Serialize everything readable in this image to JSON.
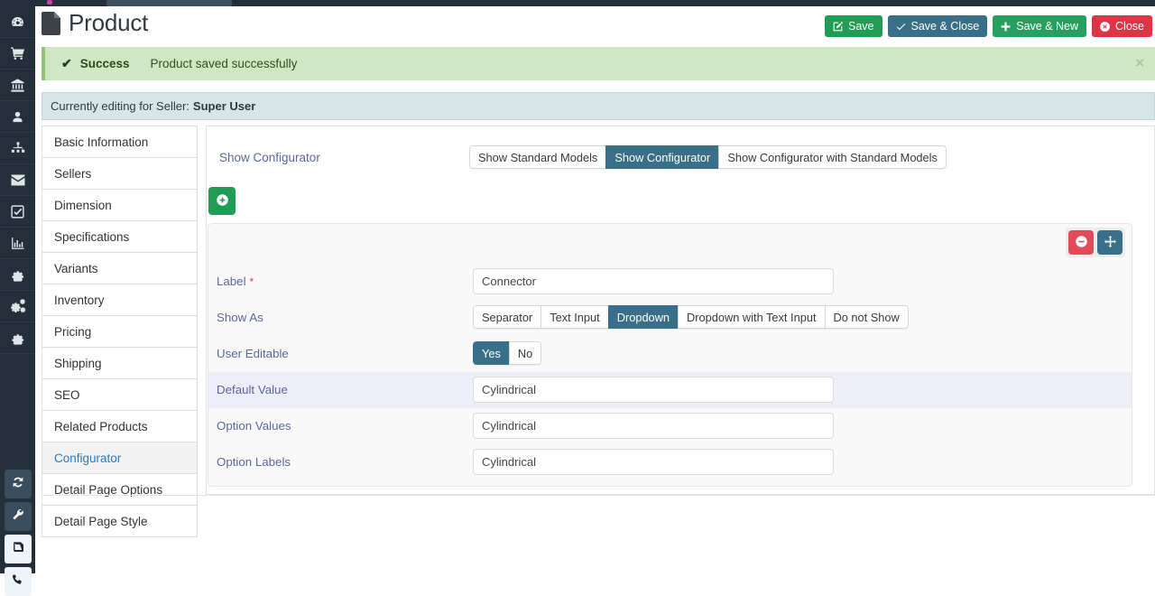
{
  "header": {
    "title": "Product",
    "doc_icon": "document-icon",
    "buttons": [
      {
        "label": "Save",
        "icon": "edit-icon",
        "style": "green"
      },
      {
        "label": "Save & Close",
        "icon": "check-icon",
        "style": "slate"
      },
      {
        "label": "Save & New",
        "icon": "plus-icon",
        "style": "green2"
      },
      {
        "label": "Close",
        "icon": "circle-x-icon",
        "style": "red"
      }
    ]
  },
  "alert": {
    "icon": "check-icon",
    "title": "Success",
    "message": "Product saved successfully",
    "close_label": "×",
    "bg_color": "#cfe8c3",
    "accent_color": "#8dc375"
  },
  "seller_bar": {
    "prefix": "Currently editing for Seller:",
    "seller": "Super User",
    "bg_color": "#d7e5e9"
  },
  "rail": {
    "items": [
      {
        "icon": "dashboard-icon"
      },
      {
        "icon": "shopping-cart-icon"
      },
      {
        "icon": "bank-icon"
      },
      {
        "icon": "user-icon"
      },
      {
        "icon": "sitemap-icon"
      },
      {
        "icon": "envelope-icon"
      },
      {
        "icon": "check-square-icon"
      },
      {
        "icon": "bar-chart-icon"
      },
      {
        "icon": "gear-icon"
      },
      {
        "icon": "gears-icon"
      },
      {
        "icon": "gear-icon"
      }
    ],
    "bottom": [
      {
        "icon": "sync-icon",
        "style": "dark"
      },
      {
        "icon": "wrench-icon",
        "style": "dark"
      },
      {
        "icon": "book-icon",
        "style": "light"
      },
      {
        "icon": "phone-icon",
        "style": "light"
      }
    ]
  },
  "tabs": {
    "active": "Configurator",
    "items": [
      {
        "label": "Basic Information"
      },
      {
        "label": "Sellers"
      },
      {
        "label": "Dimension"
      },
      {
        "label": "Specifications"
      },
      {
        "label": "Variants"
      },
      {
        "label": "Inventory"
      },
      {
        "label": "Pricing"
      },
      {
        "label": "Shipping"
      },
      {
        "label": "SEO"
      },
      {
        "label": "Related Products"
      },
      {
        "label": "Configurator"
      },
      {
        "label": "Detail Page Options"
      },
      {
        "label": "Detail Page Style"
      }
    ]
  },
  "content": {
    "show_configurator": {
      "label": "Show Configurator",
      "selected": "Show Configurator",
      "options": [
        "Show Standard Models",
        "Show Configurator",
        "Show Configurator with Standard Models"
      ]
    },
    "add_button": {
      "icon": "plus-circle-icon",
      "color": "#1f9d55"
    },
    "panel": {
      "tools": [
        {
          "icon": "minus-circle-icon",
          "name": "remove",
          "color": "#e04a59"
        },
        {
          "icon": "move-arrows-icon",
          "name": "move",
          "color": "#3a6f8a"
        }
      ],
      "rows": {
        "label": {
          "label": "Label",
          "required": "*",
          "value": "Connector"
        },
        "show_as": {
          "label": "Show As",
          "selected": "Dropdown",
          "options": [
            "Separator",
            "Text Input",
            "Dropdown",
            "Dropdown with Text Input",
            "Do not Show"
          ]
        },
        "user_editable": {
          "label": "User Editable",
          "selected": "Yes",
          "options": [
            "Yes",
            "No"
          ]
        },
        "default_value": {
          "label": "Default Value",
          "value": "Cylindrical",
          "highlighted": true
        },
        "option_values": {
          "label": "Option Values",
          "value": "Cylindrical"
        },
        "option_labels": {
          "label": "Option Labels",
          "value": "Cylindrical"
        }
      }
    }
  },
  "colors": {
    "accent_slate": "#3a6f8a",
    "label_purple": "#5b67a0",
    "danger": "#dc3545",
    "success": "#1f9d55",
    "rail_bg": "#242f3a",
    "highlight_row": "#eeeefb"
  }
}
